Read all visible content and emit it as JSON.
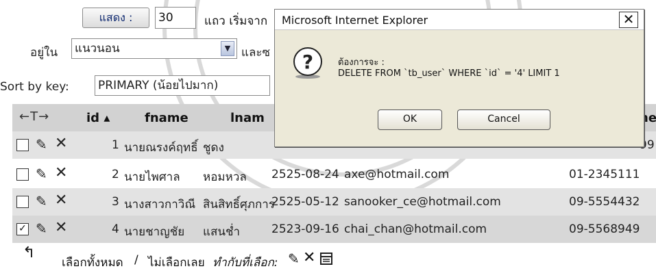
{
  "controls": {
    "show_button": "แสดง :",
    "rows_value": "30",
    "rows_suffix": "แถว เริ่มจาก",
    "in_label": "อยู่ใน",
    "direction_value": "แนวนอน",
    "and_label": "และซ",
    "sort_label": "Sort by key:",
    "sort_value": "PRIMARY (น้อยไปมาก)"
  },
  "table": {
    "headers": {
      "arrows": "←T→",
      "id": "id ▴",
      "fname": "fname",
      "lname": "lnam",
      "phone": "ne"
    },
    "rows": [
      {
        "checked": false,
        "id": "1",
        "fname": "นายณรงค์ฤทธิ์",
        "lname": "ชูดง",
        "date": "",
        "email": "",
        "phone": "99"
      },
      {
        "checked": false,
        "id": "2",
        "fname": "นายไพศาล",
        "lname": "หอมหวล",
        "date": "2525-08-24",
        "email": "axe@hotmail.com",
        "phone": "01-2345111"
      },
      {
        "checked": false,
        "id": "3",
        "fname": "นางสาวกาวิณี",
        "lname": "สินสิทธิ์ศุภการ",
        "date": "2525-05-12",
        "email": "sanooker_ce@hotmail.com",
        "phone": "09-5554432"
      },
      {
        "checked": true,
        "id": "4",
        "fname": "นายชาญชัย",
        "lname": "แสนช่ำ",
        "date": "2523-09-16",
        "email": "chai_chan@hotmail.com",
        "phone": "09-5568949"
      }
    ]
  },
  "footer": {
    "select_all": "เลือกทั้งหมด",
    "separator": "/",
    "deselect_all": "ไม่เลือกเลย",
    "with_selected": "ทำกับที่เลือก:"
  },
  "dialog": {
    "title": "Microsoft Internet Explorer",
    "close": "✕",
    "message_line1": "ต้องการจะ :",
    "message_line2": "DELETE FROM `tb_user` WHERE `id` = '4' LIMIT 1",
    "ok": "OK",
    "cancel": "Cancel"
  },
  "icons": [
    "pencil-icon",
    "delete-x-icon",
    "question-icon",
    "arrow-up-left-icon",
    "export-icon"
  ]
}
